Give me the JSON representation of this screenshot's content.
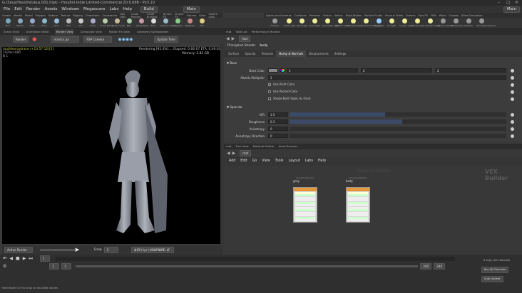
{
  "window": {
    "title": "G:/Zeus/Houdini/zeus.001.hiplc - Houdini Indie Limited-Commercial 20.0.688 - Py3.10"
  },
  "menu": {
    "items": [
      "File",
      "Edit",
      "Render",
      "Assets",
      "Windows",
      "Megascans",
      "Labs",
      "Help"
    ],
    "desktop": "Build",
    "context": "Main",
    "context_right": "Main"
  },
  "shelf_tabs_left": [
    "Create",
    "Modify",
    "Model",
    "Polygon",
    "Deform",
    "Texture",
    "Rigging",
    "Characters",
    "Constraints",
    "Hair Utils",
    "Guide Process",
    "Guide Brushes",
    "Terrain FX",
    "Simple FX",
    "Volume",
    "Solar",
    "SideFX Labs"
  ],
  "shelf_tabs_right": [
    "Lights and Cameras",
    "Collisions",
    "Particles",
    "Grains",
    "Vellum",
    "Rigid Bodies",
    "Particle Fluids",
    "Viscous Fluids",
    "Oceans",
    "Pyro FX",
    "FEM",
    "Wires",
    "Crowds",
    "Drive Simulation"
  ],
  "shelf_tools_left": [
    "Box",
    "Sphere",
    "Tube",
    "Torus",
    "Grid",
    "Null",
    "Line",
    "Circle",
    "Curve Bezier",
    "Draw Curve",
    "Path",
    "Spray Paint",
    "Font",
    "Platonic Solids",
    "L-System",
    "Metaball",
    "File"
  ],
  "shelf_tools_right": [
    "Camera",
    "Point Light",
    "Spot Light",
    "Area Light",
    "Geometry Light",
    "Volume Light",
    "Distant Light",
    "Environment Light",
    "Sky Light",
    "GI Light",
    "Caustic Light",
    "Portal Light",
    "Ambient Light",
    "Stereo Camera",
    "VR Camera",
    "Switcher",
    "Gamepad Camera"
  ],
  "left_pane": {
    "tabs": [
      "Scene View",
      "Animation Editor",
      "Render View",
      "Composite View",
      "Motion FX View",
      "Geometry Spreadsheet"
    ],
    "active_tab": "Render View",
    "path": "obj",
    "render_button": "Render",
    "renderer": "mantra_ipr",
    "camera": "RSP Camera",
    "update_time": "Update Time",
    "status_left": "/out/devraytrace (+13:57:12)[1]",
    "status_left_sub": "1920x1080",
    "status_left_line3": "B 1",
    "status_right_1": "Rendering [92.4%]....  Elapsed: 0:00:07   ETA: 0:00:01",
    "status_right_2": "Memory:             3.82 GB",
    "bottom_tab": "Active Render",
    "snap_label": "Snap",
    "snap_value": "2",
    "ship_path": "$HIP/ipr/$SNAPNAME.$F"
  },
  "right_pane": {
    "tabs": [
      "mat",
      "Take List",
      "Performance Monitor"
    ],
    "path": "mat",
    "shader_type": "Principled Shader",
    "shader_name": "body",
    "param_tabs": [
      "Surface",
      "Opacity",
      "Textures",
      "Bump & Normals",
      "Displacement",
      "Settings"
    ],
    "active_param_tab": "Bump & Normals",
    "section_base": "Base",
    "base_color_label": "Base Color",
    "base_color_values": [
      "2",
      "2",
      "2"
    ],
    "albedo_label": "Albedo Multiplier",
    "albedo_value": "1",
    "use_point_color": "Use Point Color",
    "use_packed_color": "Use Packed Color",
    "shade_both_sides": "Shade Both Sides As Front",
    "section_specular": "Specular",
    "ior_label": "IOR",
    "ior_value": "1.5",
    "ior_fill": 0.44,
    "roughness_label": "Roughness",
    "roughness_value": "0.3",
    "roughness_fill": 0.52,
    "anisotropy_label": "Anisotropy",
    "anisotropy_value": "0",
    "aniso_dir_label": "Anisotropy Direction",
    "aniso_dir_value": "0"
  },
  "network": {
    "tabs": [
      "mat",
      "Tree View",
      "Material Palette",
      "Asset Browser"
    ],
    "path": "mat",
    "menu": [
      "Add",
      "Edit",
      "Go",
      "View",
      "Tools",
      "Layout",
      "Labs",
      "Help"
    ],
    "watermark": "VEX Builder",
    "faded_title": "Material Palette",
    "nodes": [
      {
        "label": "gray",
        "subtitle": "principledshader"
      },
      {
        "label": "body",
        "subtitle": "principledshader"
      }
    ]
  },
  "timeline": {
    "frame": "1",
    "start": "1",
    "end": "240",
    "end2": "240",
    "keys_label": "0 keys, 0/0 channels",
    "key_all": "Key All Channels",
    "auto_update": "Auto Update",
    "status_message": "Hold down Ctrl to snap to rounded values"
  },
  "colors": {
    "accent": "#e3963a",
    "viewport_bg": "#000000",
    "status_yellow": "#cdd84a"
  }
}
